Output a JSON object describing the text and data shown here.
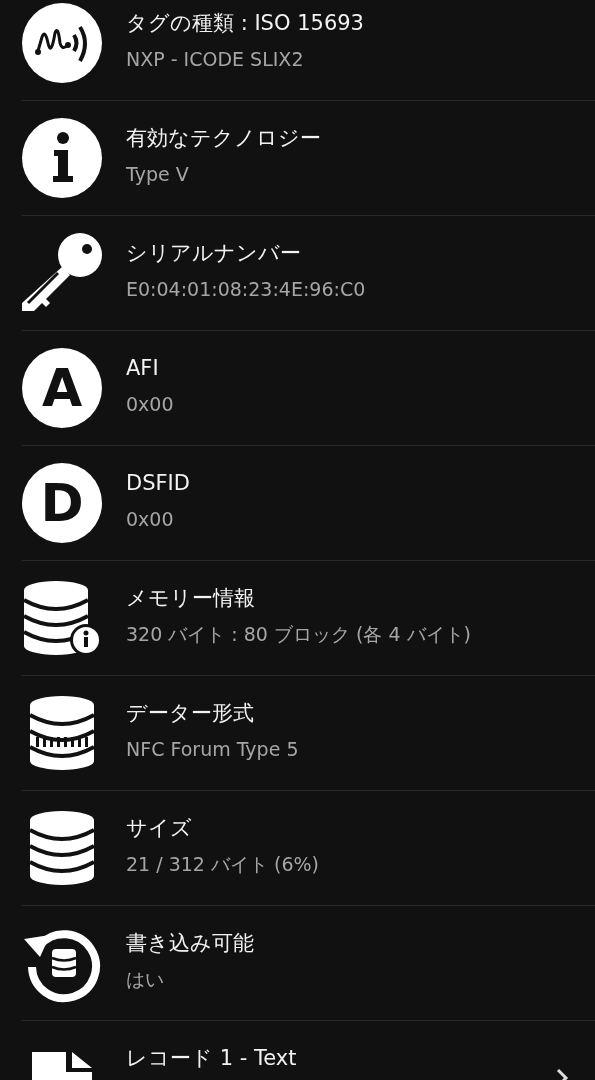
{
  "rows": [
    {
      "kind": "tag",
      "title": "タグの種類 : ISO 15693",
      "subtitle": "NXP - ICODE SLIX2",
      "chevron": false
    },
    {
      "kind": "info",
      "title": "有効なテクノロジー",
      "subtitle": "Type V",
      "chevron": false
    },
    {
      "kind": "key",
      "title": "シリアルナンバー",
      "subtitle": "E0:04:01:08:23:4E:96:C0",
      "chevron": false
    },
    {
      "kind": "letter",
      "letter": "A",
      "title": "AFI",
      "subtitle": "0x00",
      "chevron": false
    },
    {
      "kind": "letter",
      "letter": "D",
      "title": "DSFID",
      "subtitle": "0x00",
      "chevron": false
    },
    {
      "kind": "db-info",
      "title": "メモリー情報",
      "subtitle": "320 バイト : 80 ブロック (各 4 バイト)",
      "chevron": false
    },
    {
      "kind": "db-striped",
      "title": "データー形式",
      "subtitle": "NFC Forum Type 5",
      "chevron": false
    },
    {
      "kind": "db",
      "title": "サイズ",
      "subtitle": "21 / 312 バイト (6%)",
      "chevron": false
    },
    {
      "kind": "db-refresh",
      "title": "書き込み可能",
      "subtitle": "はい",
      "chevron": false
    },
    {
      "kind": "document",
      "title": "レコード 1 - Text",
      "chevron": true
    }
  ]
}
